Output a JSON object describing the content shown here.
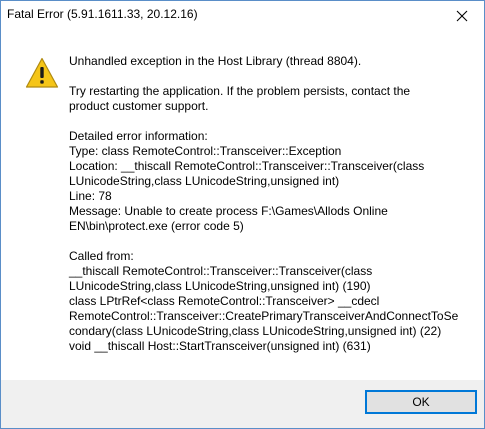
{
  "window": {
    "title": "Fatal Error (5.91.1611.33, 20.12.16)"
  },
  "message": {
    "headline": "Unhandled exception in the Host Library (thread 8804).",
    "advice_1": "Try restarting the application. If the problem persists, contact the",
    "advice_2": "product customer support.",
    "details_header": "Detailed error information:",
    "type_line": "Type: class RemoteControl::Transceiver::Exception",
    "location_1": "Location: __thiscall RemoteControl::Transceiver::Transceiver(class",
    "location_2": "LUnicodeString,class LUnicodeString,unsigned int)",
    "line": "Line: 78",
    "message_1": "Message: Unable to create process F:\\Games\\Allods Online",
    "message_2": "EN\\bin\\protect.exe (error code 5)",
    "called_from": "Called from:",
    "call_1a": "__thiscall RemoteControl::Transceiver::Transceiver(class",
    "call_1b": "LUnicodeString,class LUnicodeString,unsigned int) (190)",
    "call_2a": "class LPtrRef<class RemoteControl::Transceiver> __cdecl",
    "call_2b": "RemoteControl::Transceiver::CreatePrimaryTransceiverAndConnectToSe",
    "call_2c": "condary(class LUnicodeString,class LUnicodeString,unsigned int) (22)",
    "call_3": "void __thiscall Host::StartTransceiver(unsigned int) (631)"
  },
  "buttons": {
    "ok_label": "OK"
  },
  "icons": {
    "warning": "warning-triangle-icon",
    "close": "close-icon"
  },
  "colors": {
    "accent": "#0078d7",
    "warning_fill": "#f5c518",
    "footer_bg": "#f0f0f0"
  }
}
